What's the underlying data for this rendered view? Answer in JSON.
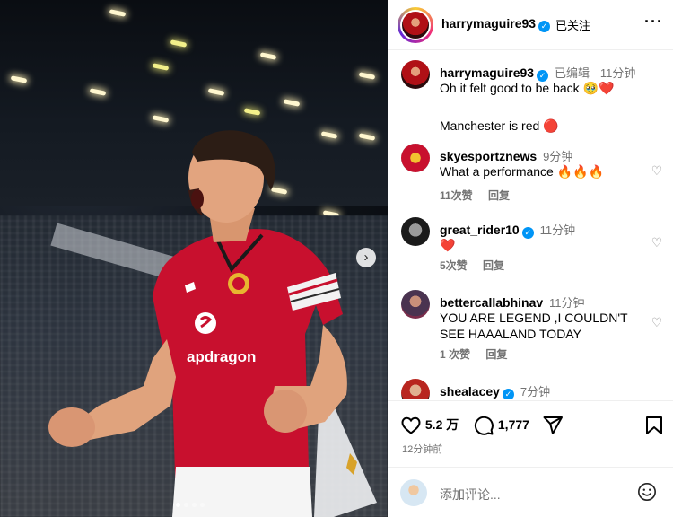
{
  "post_author": {
    "username": "harrymaguire93",
    "follow_status": "已关注"
  },
  "caption": {
    "username": "harrymaguire93",
    "edited_label": "已编辑",
    "time": "11分钟",
    "line1": "Oh it felt good to be back 🥹❤️",
    "line2": "Manchester is red 🔴"
  },
  "comments": [
    {
      "username": "skyesportznews",
      "verified": false,
      "time": "9分钟",
      "text": "What a performance 🔥🔥🔥",
      "likes": "11次赞",
      "reply": "回复"
    },
    {
      "username": "great_rider10",
      "verified": true,
      "time": "11分钟",
      "text": "❤️",
      "likes": "5次赞",
      "reply": "回复"
    },
    {
      "username": "bettercallabhinav",
      "verified": false,
      "time": "11分钟",
      "text": "YOU ARE LEGEND ,I COULDN'T SEE HAAALAND TODAY",
      "likes": "1 次赞",
      "reply": "回复"
    },
    {
      "username": "shealacey",
      "verified": true,
      "time": "7分钟",
      "text": "",
      "likes": "",
      "reply": ""
    }
  ],
  "actions": {
    "like_count": "5.2 万",
    "comment_count": "1,777",
    "posted_time": "12分钟前"
  },
  "add_comment": {
    "placeholder": "添加评论..."
  },
  "icons": {
    "more": "more-options-icon",
    "like": "heart-icon",
    "comment": "comment-bubble-icon",
    "share": "paper-plane-icon",
    "save": "bookmark-icon",
    "emoji": "emoji-smile-icon",
    "next": "chevron-right-icon"
  },
  "colors": {
    "verified_blue": "#0095f6",
    "jersey_red": "#c8102e",
    "muted_text": "#737373"
  },
  "carousel": {
    "slide_count": 4,
    "active_slide": 1
  }
}
